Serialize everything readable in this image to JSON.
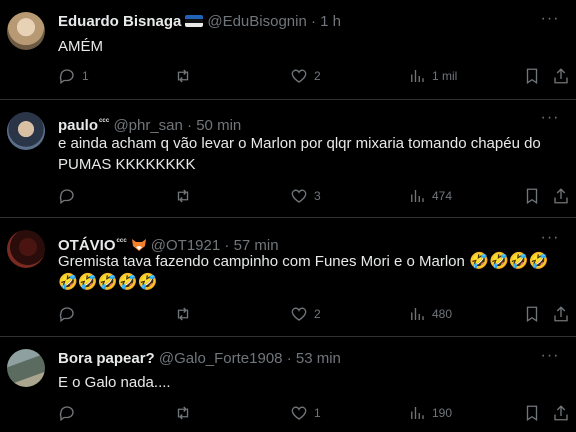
{
  "tweets": [
    {
      "name": "Eduardo Bisnaga",
      "handle": "@EduBisognin",
      "time": "1 h",
      "text": "AMÉM",
      "stats": {
        "replies": "1",
        "retweets": "",
        "likes": "2",
        "views": "1 mil"
      }
    },
    {
      "name": "paulo",
      "badge": "ᶜᶜᶜ",
      "handle": "@phr_san",
      "time": "50 min",
      "text": "e ainda acham q vão levar o Marlon por qlqr mixaria tomando chapéu do PUMAS KKKKKKKK",
      "stats": {
        "replies": "",
        "retweets": "",
        "likes": "3",
        "views": "474"
      }
    },
    {
      "name": "OTÁVIO",
      "badge": "ᶜᶜᶜ",
      "handle": "@OT1921",
      "time": "57 min",
      "text": "Gremista tava fazendo campinho com Funes Mori e o Marlon",
      "emojis": "🤣🤣🤣🤣",
      "emojis2": "🤣🤣🤣🤣🤣",
      "stats": {
        "replies": "",
        "retweets": "",
        "likes": "2",
        "views": "480"
      }
    },
    {
      "name": "Bora papear?",
      "handle": "@Galo_Forte1908",
      "time": "53 min",
      "text": "E o Galo nada....",
      "stats": {
        "replies": "",
        "retweets": "",
        "likes": "1",
        "views": "190"
      }
    }
  ],
  "ui": {
    "separator": "·",
    "more": "···"
  }
}
